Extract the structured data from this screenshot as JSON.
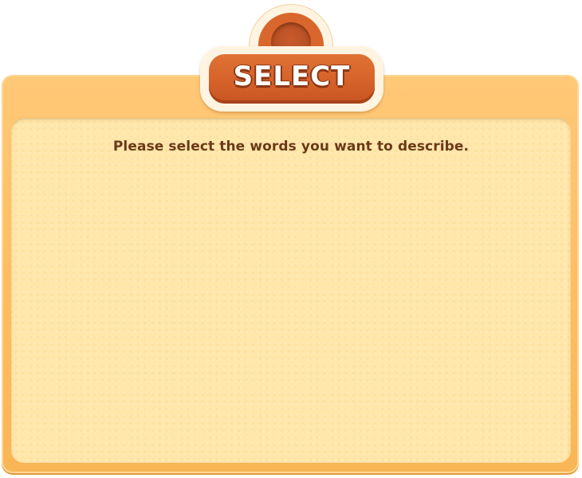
{
  "dialog": {
    "title": "SELECT",
    "instruction": "Please select the words you want to describe."
  },
  "colors": {
    "frame": "#ffbe62",
    "panel": "#ffe6a9",
    "badge": "#d6622a",
    "instruction_text": "#6b3a18"
  }
}
